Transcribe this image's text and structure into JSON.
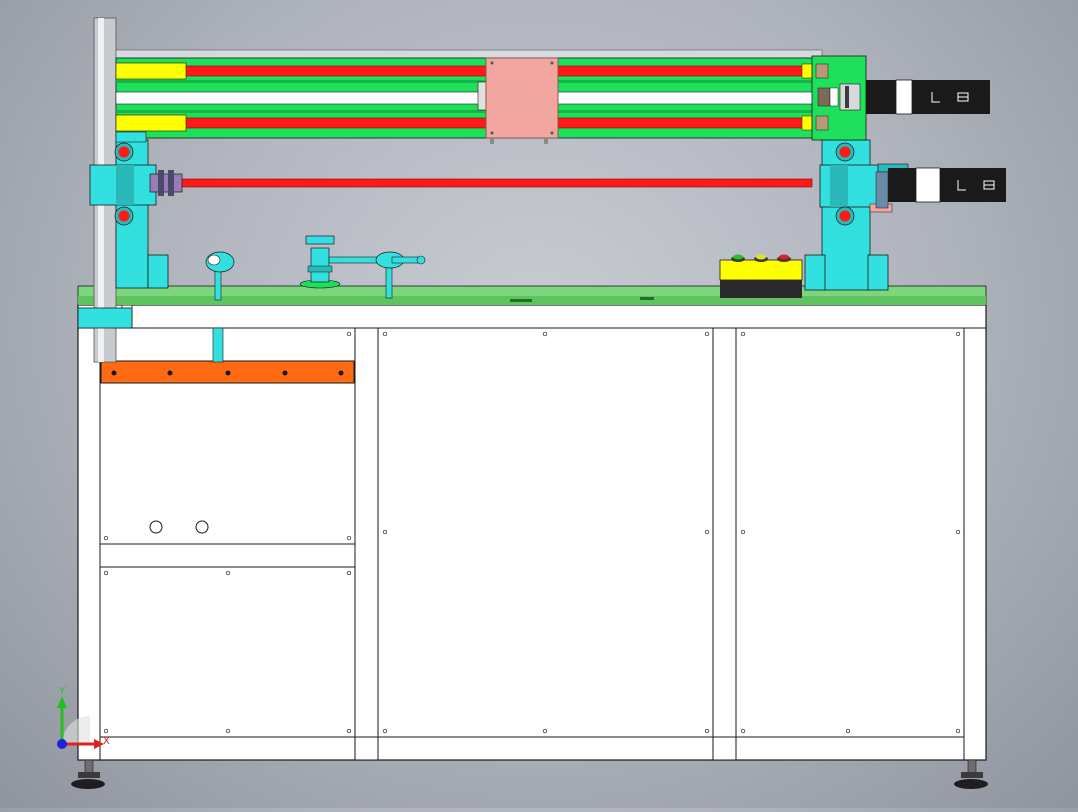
{
  "view": {
    "background_top": "#c9ccd3",
    "background_bottom": "#8f949e"
  },
  "colors": {
    "frame": "#ffffff",
    "frame_line": "#1a1a1a",
    "rail_green": "#1ee05a",
    "rod_red": "#ff1a1a",
    "guide_yellow": "#ffff00",
    "support_cyan": "#33e0e0",
    "carriage_pink": "#f2a6a0",
    "plate_orange": "#ff6a13",
    "motor_black": "#1a1a1a",
    "deck_green": "#7dd67d",
    "column_gray": "#bfc3c8"
  },
  "triad": {
    "y_label": "Y",
    "x_label": "X",
    "y_color": "#22c022",
    "x_color": "#e02020",
    "origin_color": "#2020e0"
  },
  "control_box": {
    "button_colors": [
      "#1ec81e",
      "#e8e020",
      "#e02020"
    ]
  }
}
